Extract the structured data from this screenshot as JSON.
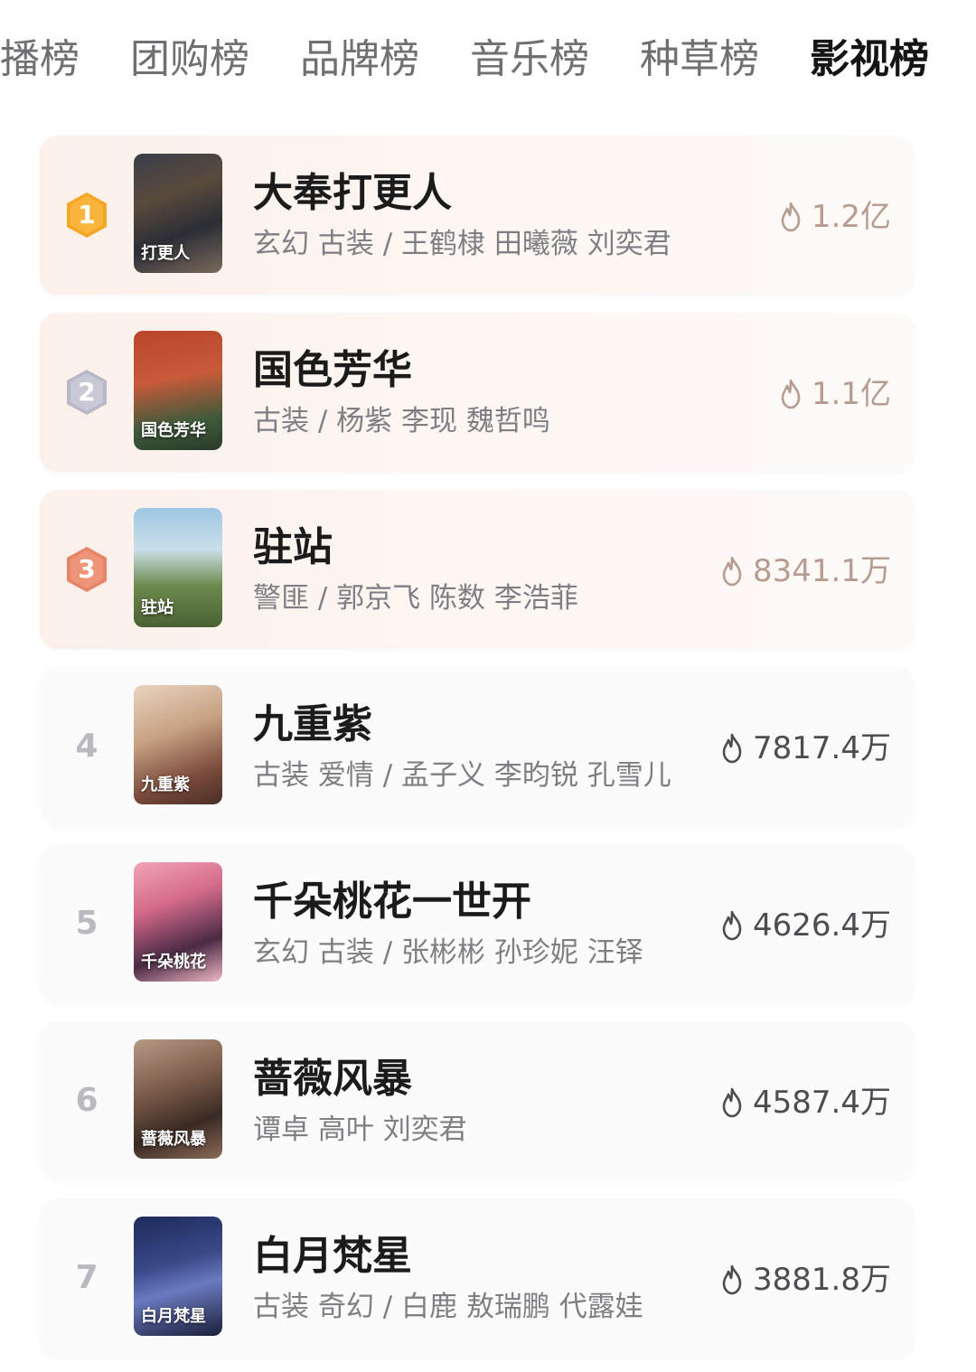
{
  "tabs": [
    {
      "label": "播榜",
      "active": false
    },
    {
      "label": "团购榜",
      "active": false
    },
    {
      "label": "品牌榜",
      "active": false
    },
    {
      "label": "音乐榜",
      "active": false
    },
    {
      "label": "种草榜",
      "active": false
    },
    {
      "label": "影视榜",
      "active": true
    }
  ],
  "colors": {
    "gold": "#f5a623",
    "silver": "#b8b8c8",
    "bronze": "#e88466",
    "top_heat": "#b79c91",
    "rest_heat": "#4c4c52"
  },
  "items": [
    {
      "rank": "1",
      "title": "大奉打更人",
      "meta": "玄幻 古装 / 王鹤棣 田曦薇 刘奕君",
      "heat": "1.2亿",
      "poster_text": "打更人"
    },
    {
      "rank": "2",
      "title": "国色芳华",
      "meta": "古装 / 杨紫 李现 魏哲鸣",
      "heat": "1.1亿",
      "poster_text": "国色芳华"
    },
    {
      "rank": "3",
      "title": "驻站",
      "meta": "警匪 / 郭京飞 陈数 李浩菲",
      "heat": "8341.1万",
      "poster_text": "驻站"
    },
    {
      "rank": "4",
      "title": "九重紫",
      "meta": "古装 爱情 / 孟子义 李昀锐 孔雪儿",
      "heat": "7817.4万",
      "poster_text": "九重紫"
    },
    {
      "rank": "5",
      "title": "千朵桃花一世开",
      "meta": "玄幻 古装 / 张彬彬 孙珍妮 汪铎",
      "heat": "4626.4万",
      "poster_text": "千朵桃花"
    },
    {
      "rank": "6",
      "title": "蔷薇风暴",
      "meta": "谭卓 高叶 刘奕君",
      "heat": "4587.4万",
      "poster_text": "蔷薇风暴"
    },
    {
      "rank": "7",
      "title": "白月梵星",
      "meta": "古装 奇幻 / 白鹿 敖瑞鹏 代露娃",
      "heat": "3881.8万",
      "poster_text": "白月梵星"
    }
  ]
}
